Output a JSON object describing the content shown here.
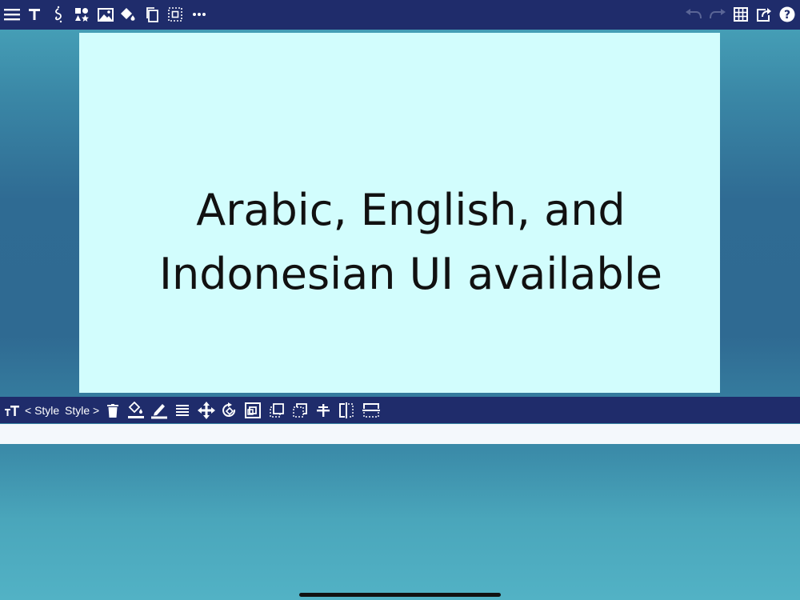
{
  "toolbar": {
    "left_icons": [
      "menu-icon",
      "text-icon",
      "calligraphy-icon",
      "shapes-icon",
      "image-icon",
      "paint-bucket-icon",
      "copy-icon",
      "select-icon",
      "more-icon"
    ],
    "right_icons": [
      "undo-icon",
      "redo-icon",
      "grid-icon",
      "share-icon",
      "help-icon"
    ],
    "bar_color": "#1f2c6b",
    "disabled_icon_color": "#5a6596"
  },
  "slide": {
    "background": "#d2fdfd",
    "text_line_1": "Arabic, English, and",
    "text_line_2": "Indonesian UI available",
    "text_color": "#111111"
  },
  "format_bar": {
    "prev_style_label": "< Style",
    "next_style_label": "Style >",
    "icons": [
      "font-size-icon",
      "delete-icon",
      "fill-color-icon",
      "stroke-color-icon",
      "line-spacing-icon",
      "move-icon",
      "rotate-icon",
      "frame-icon",
      "bring-forward-icon",
      "send-backward-icon",
      "align-center-icon",
      "flip-horizontal-icon",
      "flip-vertical-icon"
    ]
  }
}
